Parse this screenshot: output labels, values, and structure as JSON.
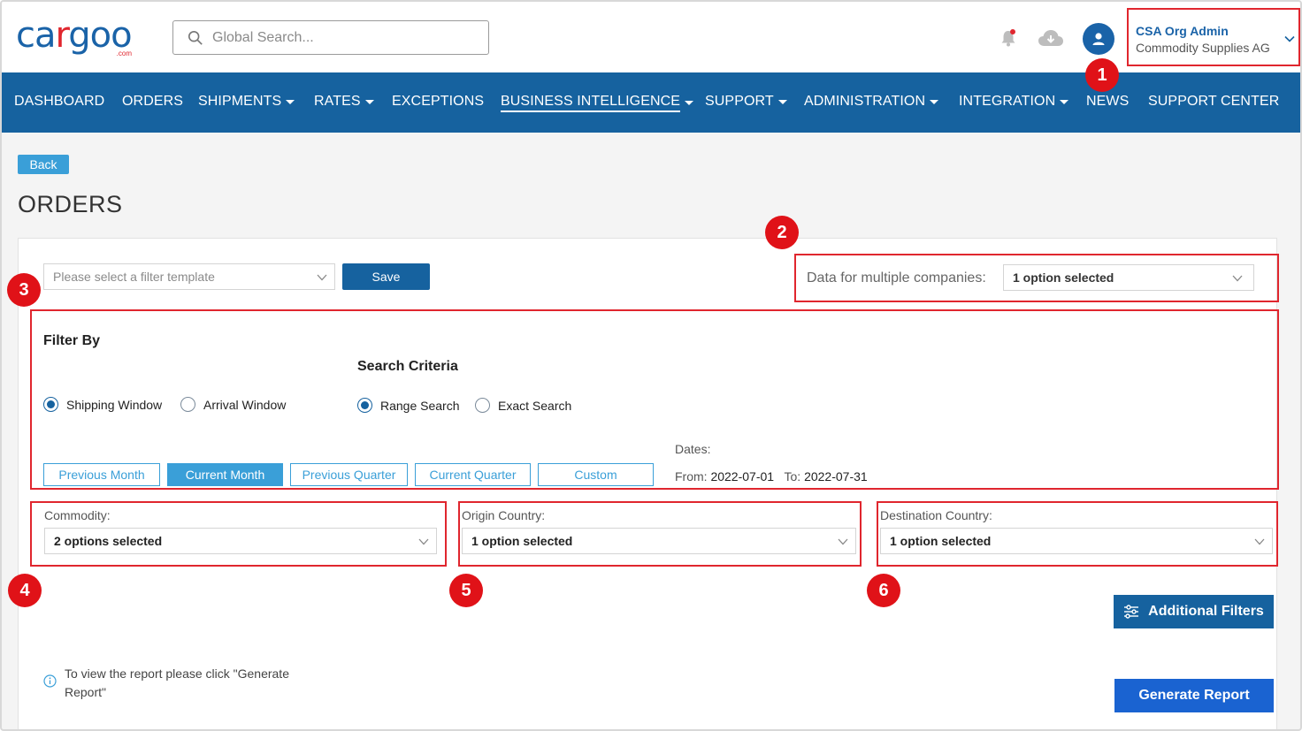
{
  "header": {
    "logo_text": "cargoo",
    "logo_suffix": ".com",
    "search_placeholder": "Global Search...",
    "user_name": "CSA Org Admin",
    "user_org": "Commodity Supplies AG"
  },
  "nav": {
    "items": [
      {
        "label": "DASHBOARD"
      },
      {
        "label": "ORDERS"
      },
      {
        "label": "SHIPMENTS"
      },
      {
        "label": "RATES"
      },
      {
        "label": "EXCEPTIONS"
      },
      {
        "label": "BUSINESS INTELLIGENCE"
      },
      {
        "label": "SUPPORT"
      },
      {
        "label": "ADMINISTRATION"
      },
      {
        "label": "INTEGRATION"
      },
      {
        "label": "NEWS"
      },
      {
        "label": "SUPPORT CENTER"
      }
    ],
    "active": "BUSINESS INTELLIGENCE"
  },
  "page": {
    "back_label": "Back",
    "title": "ORDERS"
  },
  "template": {
    "placeholder": "Please select a filter template",
    "save_label": "Save"
  },
  "multi_company": {
    "label": "Data for multiple companies:",
    "value": "1 option selected"
  },
  "filter": {
    "title": "Filter By",
    "options": [
      "Shipping Window",
      "Arrival Window"
    ],
    "selected": "Shipping Window",
    "search_title": "Search Criteria",
    "search_options": [
      "Range Search",
      "Exact Search"
    ],
    "search_selected": "Range Search",
    "periods": [
      "Previous Month",
      "Current Month",
      "Previous Quarter",
      "Current Quarter",
      "Custom"
    ],
    "active_period": "Current Month",
    "dates_label": "Dates:",
    "from_label": "From:",
    "from_value": "2022-07-01",
    "to_label": "To:",
    "to_value": "2022-07-31"
  },
  "selects": {
    "commodity": {
      "label": "Commodity:",
      "value": "2 options selected"
    },
    "origin": {
      "label": "Origin Country:",
      "value": "1 option selected"
    },
    "destination": {
      "label": "Destination Country:",
      "value": "1 option selected"
    }
  },
  "badges": [
    "1",
    "2",
    "3",
    "4",
    "5",
    "6"
  ],
  "actions": {
    "additional_filters": "Additional Filters",
    "info_text": "To view the report please click \"Generate Report\"",
    "generate_report": "Generate Report"
  },
  "colors": {
    "brand_blue": "#16629f",
    "accent_light_blue": "#3a9fd8",
    "highlight_red": "#e0262e"
  }
}
